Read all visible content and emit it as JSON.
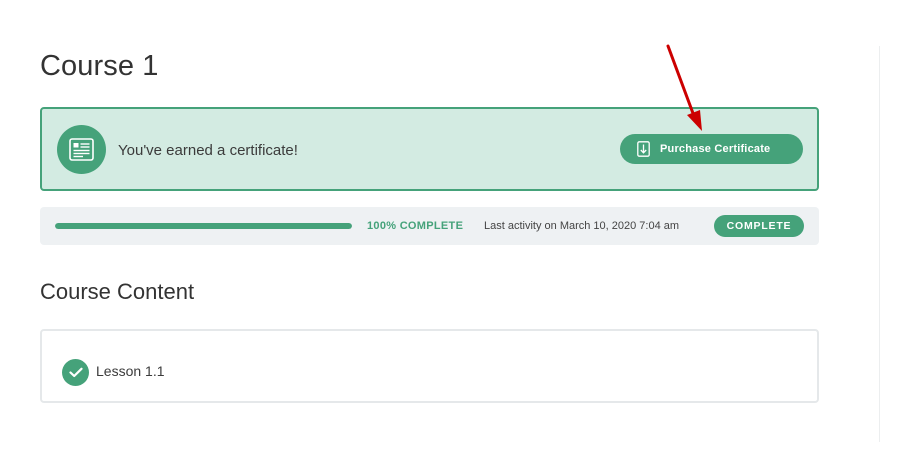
{
  "course": {
    "title": "Course 1"
  },
  "certificate": {
    "message": "You've earned a certificate!",
    "purchase_label": "Purchase Certificate"
  },
  "progress": {
    "fraction": 1.0,
    "percent_label": "100% COMPLETE",
    "last_activity": "Last activity on March 10, 2020 7:04 am",
    "status_badge": "COMPLETE"
  },
  "content": {
    "heading": "Course Content",
    "lessons": [
      {
        "label": "Lesson 1.1",
        "completed": true
      }
    ]
  },
  "colors": {
    "accent": "#45a27a",
    "banner_bg": "#d3ebe2",
    "annotation_arrow": "#cc0000"
  },
  "icons": {
    "certificate": "certificate-icon",
    "download": "download-icon",
    "check": "check-icon"
  }
}
